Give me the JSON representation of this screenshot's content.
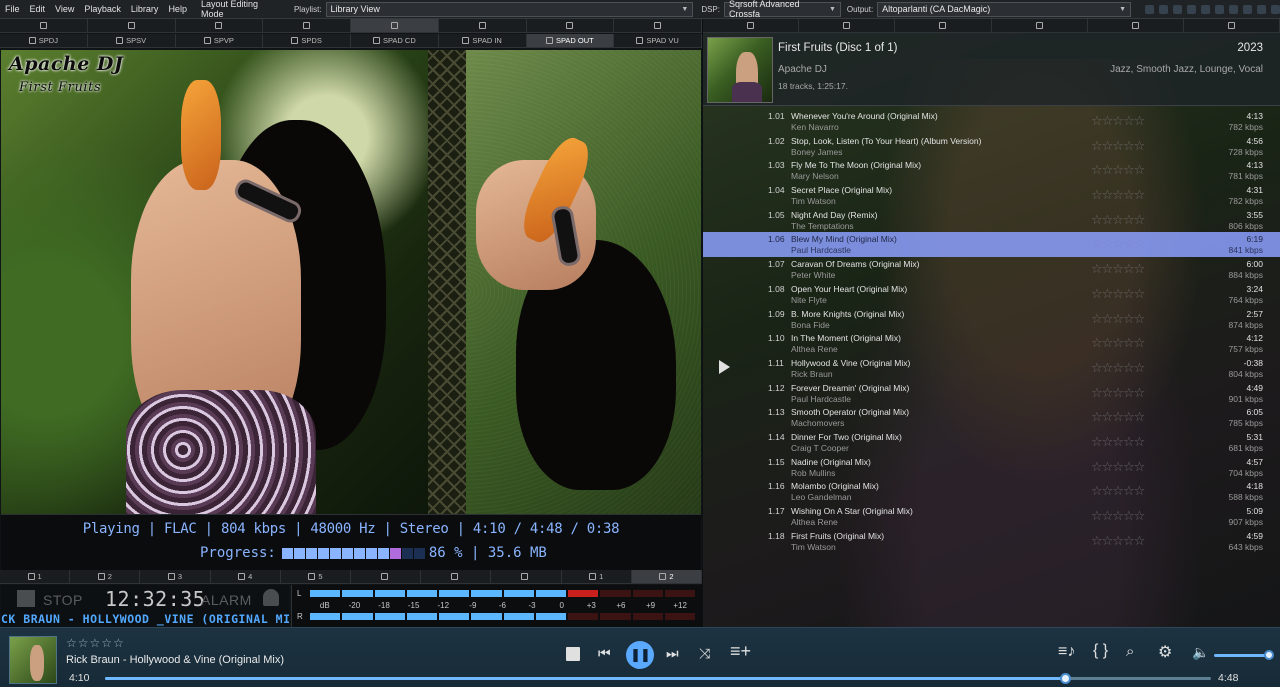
{
  "menubar": {
    "items": [
      "File",
      "Edit",
      "View",
      "Playback",
      "Library",
      "Help",
      "Layout Editing Mode"
    ],
    "playlist_label": "Playlist:",
    "playlist_value": "Library View",
    "dsp_label": "DSP:",
    "dsp_value": "Sqrsoft Advanced Crossfa",
    "output_label": "Output:",
    "output_value": "Altoparlanti (CA DacMagic)"
  },
  "left_tabs_top": [
    {
      "icon": "document-icon"
    },
    {
      "icon": "image-icon"
    },
    {
      "icon": "image-icon"
    },
    {
      "icon": "image-icon"
    },
    {
      "icon": "disc-icon"
    },
    {
      "icon": "monitor-icon"
    },
    {
      "icon": "file-icon"
    },
    {
      "icon": "gear-icon"
    }
  ],
  "left_tabs_spad": [
    {
      "label": "SPDJ"
    },
    {
      "label": "SPSV"
    },
    {
      "label": "SPVP"
    },
    {
      "label": "SPDS"
    },
    {
      "label": "SPAD CD"
    },
    {
      "label": "SPAD IN"
    },
    {
      "label": "SPAD OUT",
      "active": true
    },
    {
      "label": "SPAD VU"
    }
  ],
  "artwork": {
    "title": "Apache DJ",
    "subtitle": "First Fruits",
    "theme": "Apache Evolution Theme"
  },
  "status": {
    "line": "Playing | FLAC | 804 kbps | 48000 Hz | Stereo | 4:10 / 4:48 / 0:38",
    "progress_label": "Progress:",
    "progress_text": "86 % | 35.6 MB",
    "progress_fraction": 0.86
  },
  "bottom_tabs": [
    {
      "label": "1"
    },
    {
      "label": "2"
    },
    {
      "label": "3"
    },
    {
      "label": "4"
    },
    {
      "label": "5"
    },
    {
      "label": ""
    },
    {
      "label": ""
    },
    {
      "label": ""
    },
    {
      "label": "1"
    },
    {
      "label": "2",
      "active": true
    }
  ],
  "clock": {
    "stop_label": "STOP",
    "time": "12:32:35",
    "alarm_label": "ALARM",
    "marquee": "CK BRAUN - HOLLYWOOD _VINE (ORIGINAL MIX) - FIRST"
  },
  "vu": {
    "left_label": "L",
    "right_label": "R",
    "scale": [
      "dB",
      "-20",
      "-18",
      "-15",
      "-12",
      "-9",
      "-6",
      "-3",
      "0",
      "+3",
      "+6",
      "+9",
      "+12"
    ]
  },
  "right_tabs": [
    {
      "icon": "document-icon"
    },
    {
      "icon": "image-icon"
    },
    {
      "icon": "image-icon"
    },
    {
      "icon": "monitor-icon"
    },
    {
      "icon": "brush-icon"
    },
    {
      "icon": "tools-icon"
    }
  ],
  "album": {
    "title": "First Fruits (Disc 1 of 1)",
    "year": "2023",
    "artist": "Apache DJ",
    "genre": "Jazz, Smooth Jazz, Lounge, Vocal",
    "tracks_info": "18 tracks, 1:25:17."
  },
  "tracks": [
    {
      "num": "1.01",
      "title": "Whenever You're Around (Original Mix)",
      "artist": "Ken Navarro",
      "duration": "4:13",
      "bitrate": "782 kbps"
    },
    {
      "num": "1.02",
      "title": "Stop, Look, Listen (To Your Heart) (Album Version)",
      "artist": "Boney James",
      "duration": "4:56",
      "bitrate": "728 kbps"
    },
    {
      "num": "1.03",
      "title": "Fly Me To The Moon (Original Mix)",
      "artist": "Mary Nelson",
      "duration": "4:13",
      "bitrate": "781 kbps"
    },
    {
      "num": "1.04",
      "title": "Secret Place (Original Mix)",
      "artist": "Tim Watson",
      "duration": "4:31",
      "bitrate": "782 kbps"
    },
    {
      "num": "1.05",
      "title": "Night And Day (Remix)",
      "artist": "The Temptations",
      "duration": "3:55",
      "bitrate": "806 kbps"
    },
    {
      "num": "1.06",
      "title": "Blew My Mind (Original Mix)",
      "artist": "Paul Hardcastle",
      "duration": "6:19",
      "bitrate": "841 kbps",
      "selected": true
    },
    {
      "num": "1.07",
      "title": "Caravan Of Dreams (Original Mix)",
      "artist": "Peter White",
      "duration": "6:00",
      "bitrate": "884 kbps"
    },
    {
      "num": "1.08",
      "title": "Open Your Heart (Original Mix)",
      "artist": "Nite Flyte",
      "duration": "3:24",
      "bitrate": "764 kbps"
    },
    {
      "num": "1.09",
      "title": "B. More Knights (Original Mix)",
      "artist": "Bona Fide",
      "duration": "2:57",
      "bitrate": "874 kbps"
    },
    {
      "num": "1.10",
      "title": "In The Moment (Original Mix)",
      "artist": "Althea Rene",
      "duration": "4:12",
      "bitrate": "757 kbps"
    },
    {
      "num": "1.11",
      "title": "Hollywood & Vine (Original Mix)",
      "artist": "Rick Braun",
      "duration": "-0:38",
      "bitrate": "804 kbps",
      "playing": true
    },
    {
      "num": "1.12",
      "title": "Forever Dreamin' (Original Mix)",
      "artist": "Paul Hardcastle",
      "duration": "4:49",
      "bitrate": "901 kbps"
    },
    {
      "num": "1.13",
      "title": "Smooth Operator (Original Mix)",
      "artist": "Machomovers",
      "duration": "6:05",
      "bitrate": "785 kbps"
    },
    {
      "num": "1.14",
      "title": "Dinner For Two (Original Mix)",
      "artist": "Craig T Cooper",
      "duration": "5:31",
      "bitrate": "681 kbps"
    },
    {
      "num": "1.15",
      "title": "Nadine (Original Mix)",
      "artist": "Rob Mullins",
      "duration": "4:57",
      "bitrate": "704 kbps"
    },
    {
      "num": "1.16",
      "title": "Molambo (Original Mix)",
      "artist": "Leo Gandelman",
      "duration": "4:18",
      "bitrate": "588 kbps"
    },
    {
      "num": "1.17",
      "title": "Wishing On A Star (Original Mix)",
      "artist": "Althea Rene",
      "duration": "5:09",
      "bitrate": "907 kbps"
    },
    {
      "num": "1.18",
      "title": "First Fruits (Original Mix)",
      "artist": "Tim Watson",
      "duration": "4:59",
      "bitrate": "643 kbps"
    }
  ],
  "rating_glyphs": "☆☆☆☆☆",
  "now_playing": {
    "stars": "☆☆☆☆☆",
    "title": "Rick Braun - Hollywood & Vine (Original Mix)",
    "elapsed": "4:10",
    "total": "4:48",
    "seek_fraction": 0.868,
    "volume_fraction": 0.9
  },
  "colors": {
    "accent": "#5aa9ff",
    "selection": "#8ca0ff",
    "status_text": "#8ab4ff",
    "vu_blue": "#5bb7ff",
    "vu_red": "#c9201d"
  }
}
